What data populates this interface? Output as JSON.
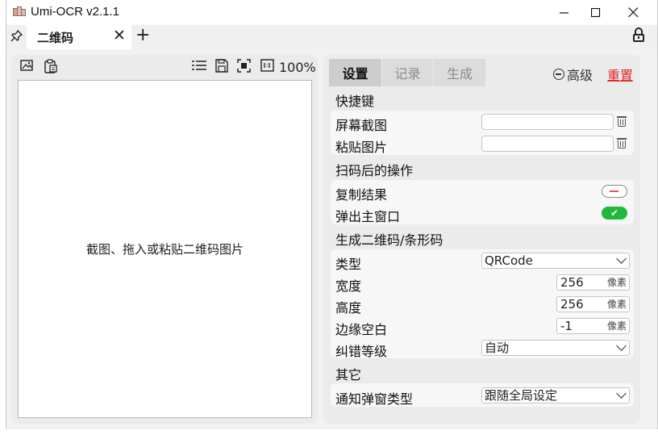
{
  "window": {
    "title": "Umi-OCR v2.1.1",
    "minimize_icon": "minimize-icon",
    "maximize_icon": "maximize-icon",
    "close_icon": "close-icon"
  },
  "tabbar": {
    "pin_icon": "pin-icon",
    "tab_label": "二维码",
    "close_glyph": "✕",
    "add_glyph": "+",
    "lock_icon": "lock-icon"
  },
  "left_toolbar": {
    "icons": [
      "image-icon",
      "paste-icon",
      "list-icon",
      "save-icon",
      "fit-screen-icon",
      "actual-size-icon"
    ],
    "zoom": "100%"
  },
  "image_area": {
    "placeholder": "截图、拖入或粘贴二维码图片"
  },
  "right_tabs": [
    {
      "label": "设置",
      "active": true
    },
    {
      "label": "记录",
      "active": false
    },
    {
      "label": "生成",
      "active": false
    }
  ],
  "actions": {
    "advanced_label": "高级",
    "reset_label": "重置"
  },
  "sections": {
    "hotkeys": {
      "title": "快捷键",
      "screenshot_label": "屏幕截图",
      "screenshot_value": "",
      "paste_label": "粘贴图片",
      "paste_value": ""
    },
    "after_scan": {
      "title": "扫码后的操作",
      "copy_label": "复制结果",
      "copy_enabled": false,
      "popup_label": "弹出主窗口",
      "popup_enabled": true,
      "check_glyph": "✔"
    },
    "generate": {
      "title": "生成二维码/条形码",
      "type_label": "类型",
      "type_value": "QRCode",
      "width_label": "宽度",
      "width_value": "256",
      "height_label": "高度",
      "height_value": "256",
      "margin_label": "边缘空白",
      "margin_value": "-1",
      "unit": "像素",
      "ec_label": "纠错等级",
      "ec_value": "自动"
    },
    "other": {
      "title": "其它",
      "notify_label": "通知弹窗类型",
      "notify_value": "跟随全局设定"
    }
  },
  "accent_colors": {
    "reset_red": "#e02828",
    "toggle_on_green": "#1fb83a"
  }
}
